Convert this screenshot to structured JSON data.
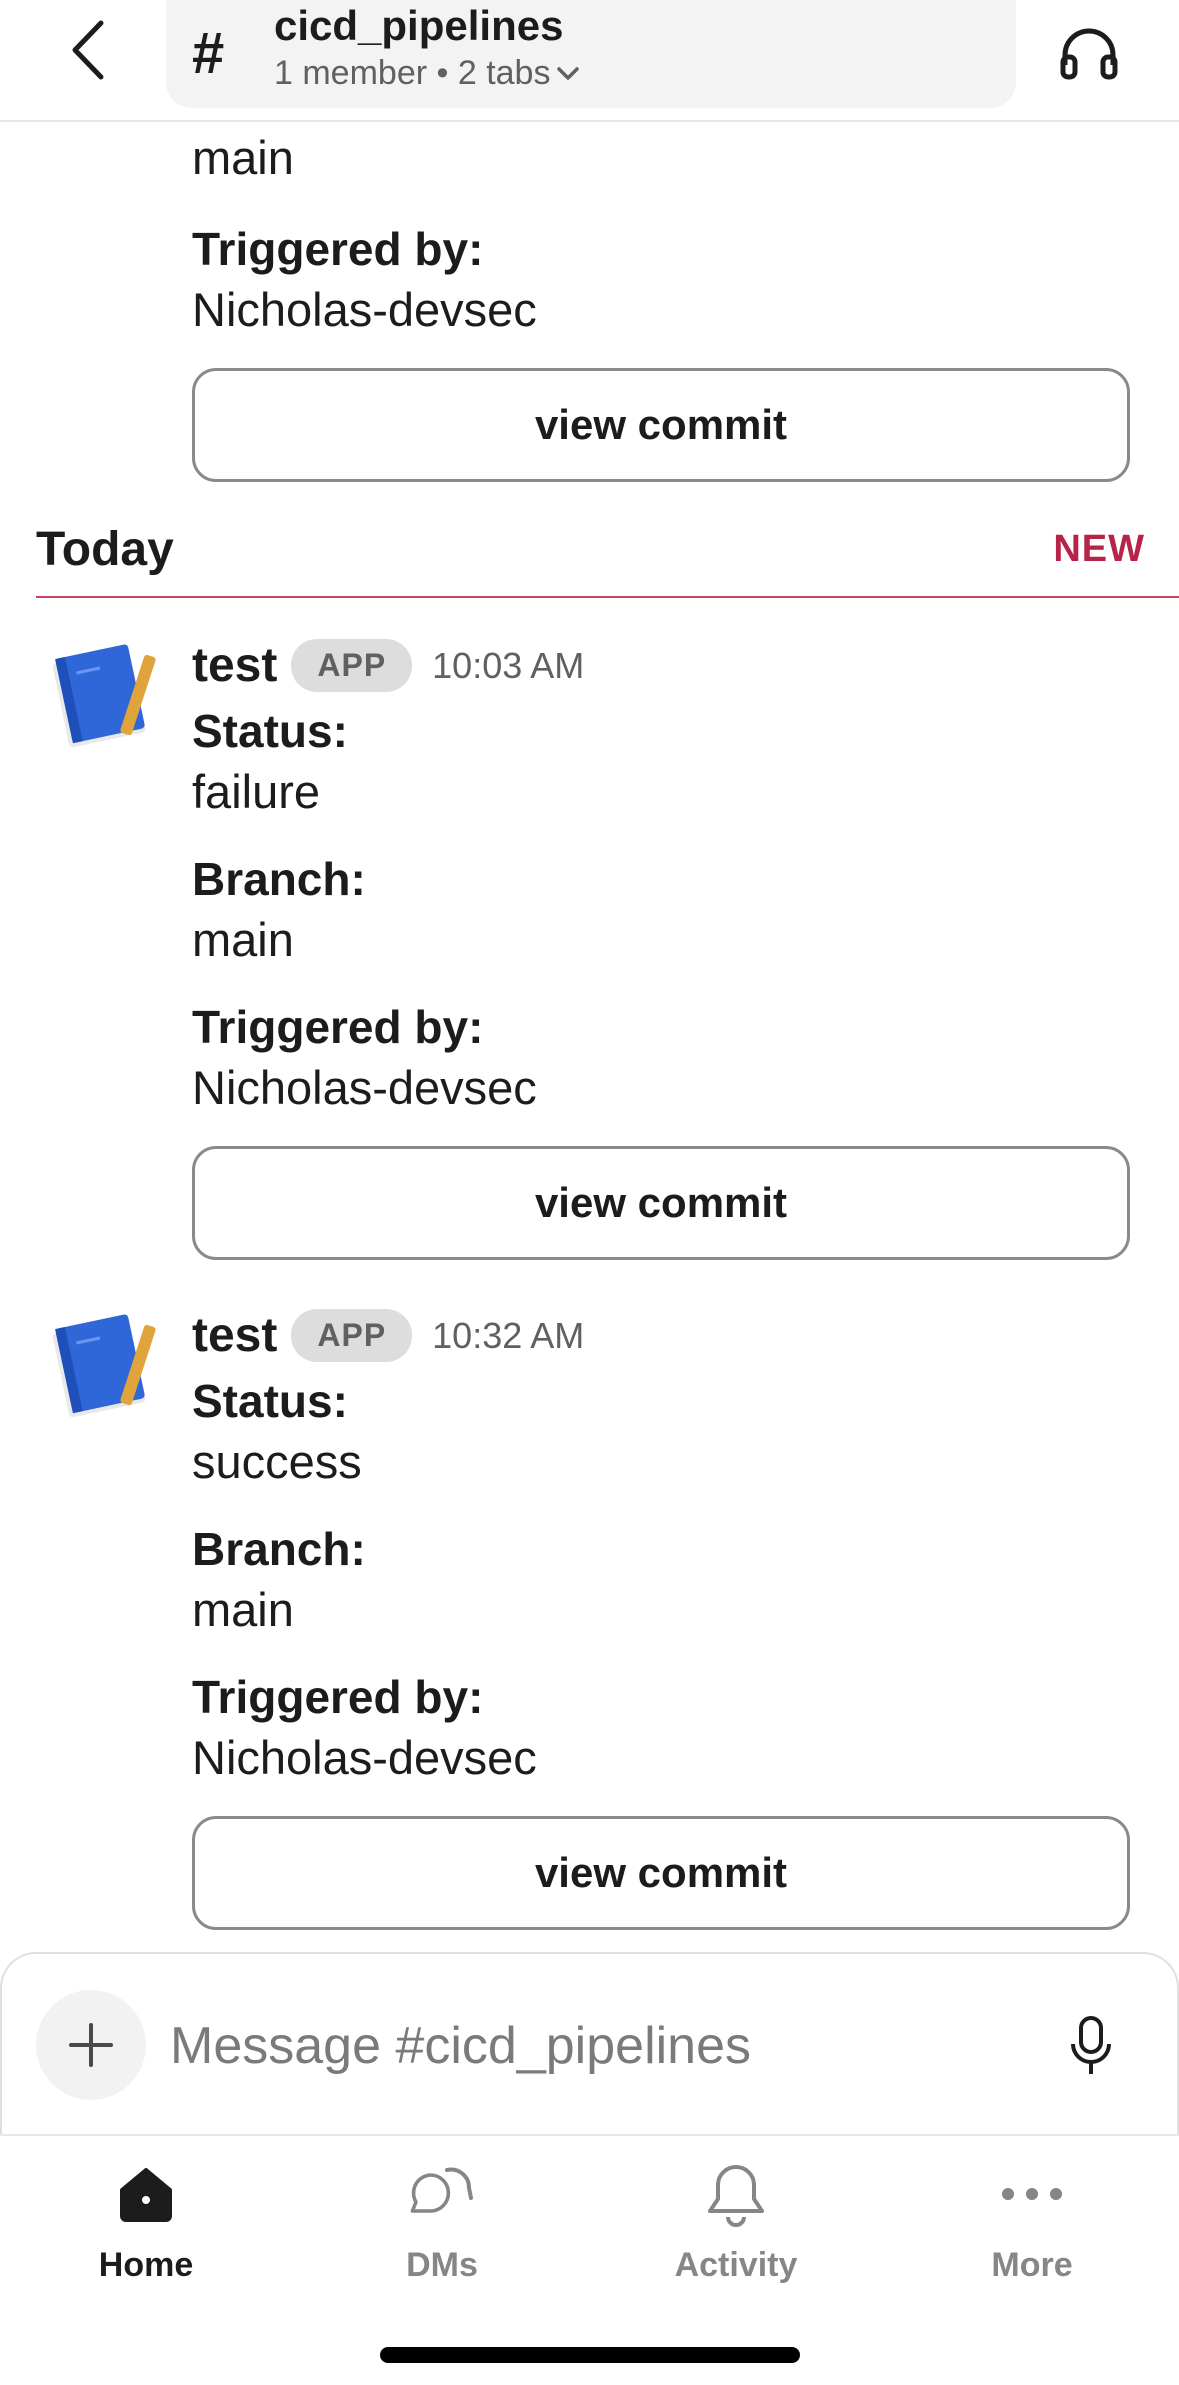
{
  "header": {
    "back_icon": "chevron-left-icon",
    "hash_symbol": "#",
    "channel_name": "cicd_pipelines",
    "channel_meta": "1 member • 2 tabs",
    "huddle_icon": "headphones-icon"
  },
  "partial_message": {
    "branch_value": "main",
    "triggered_label": "Triggered by:",
    "triggered_value": "Nicholas-devsec",
    "button_label": "view commit"
  },
  "divider": {
    "label": "Today",
    "new_label": "NEW"
  },
  "messages": [
    {
      "sender": "test",
      "badge": "APP",
      "time": "10:03 AM",
      "status_label": "Status:",
      "status_value": "failure",
      "branch_label": "Branch:",
      "branch_value": "main",
      "triggered_label": "Triggered by:",
      "triggered_value": "Nicholas-devsec",
      "button_label": "view commit"
    },
    {
      "sender": "test",
      "badge": "APP",
      "time": "10:32 AM",
      "status_label": "Status:",
      "status_value": "success",
      "branch_label": "Branch:",
      "branch_value": "main",
      "triggered_label": "Triggered by:",
      "triggered_value": "Nicholas-devsec",
      "button_label": "view commit"
    }
  ],
  "composer": {
    "placeholder": "Message #cicd_pipelines",
    "plus_icon": "plus-icon",
    "mic_icon": "microphone-icon"
  },
  "nav": {
    "items": [
      {
        "label": "Home",
        "icon": "home-icon",
        "active": true
      },
      {
        "label": "DMs",
        "icon": "dms-icon",
        "active": false
      },
      {
        "label": "Activity",
        "icon": "bell-icon",
        "active": false
      },
      {
        "label": "More",
        "icon": "more-icon",
        "active": false
      }
    ]
  },
  "colors": {
    "new_accent": "#b8234a",
    "divider_line": "#c9435f",
    "text": "#1d1c1d",
    "muted": "#616061"
  }
}
